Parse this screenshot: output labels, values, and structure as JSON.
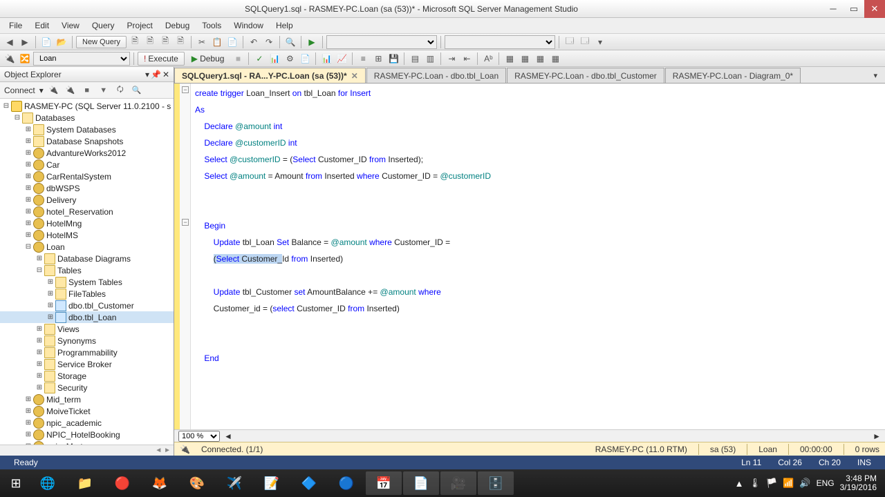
{
  "title": "SQLQuery1.sql - RASMEY-PC.Loan (sa (53))* - Microsoft SQL Server Management Studio",
  "menu": [
    "File",
    "Edit",
    "View",
    "Query",
    "Project",
    "Debug",
    "Tools",
    "Window",
    "Help"
  ],
  "toolbar": {
    "new_query": "New Query",
    "execute": "Execute",
    "debug": "Debug",
    "db_selected": "Loan"
  },
  "explorer": {
    "title": "Object Explorer",
    "connect": "Connect",
    "server": "RASMEY-PC (SQL Server 11.0.2100 - s",
    "folders": {
      "databases": "Databases",
      "sysdb": "System Databases",
      "snapshots": "Database Snapshots"
    },
    "dbs": [
      "AdvantureWorks2012",
      "Car",
      "CarRentalSystem",
      "dbWSPS",
      "Delivery",
      "hotel_Reservation",
      "HotelMng",
      "HotelMS",
      "Loan",
      "Mid_term",
      "MoiveTicket",
      "npic_academic",
      "NPIC_HotelBooking",
      "npic_Mart"
    ],
    "loan_children": {
      "diagrams": "Database Diagrams",
      "tables": "Tables",
      "systables": "System Tables",
      "filetables": "FileTables",
      "tbl_customer": "dbo.tbl_Customer",
      "tbl_loan": "dbo.tbl_Loan",
      "views": "Views",
      "synonyms": "Synonyms",
      "prog": "Programmability",
      "sb": "Service Broker",
      "storage": "Storage",
      "security": "Security"
    }
  },
  "tabs": [
    {
      "label": "SQLQuery1.sql - RA...Y-PC.Loan (sa (53))*",
      "active": true
    },
    {
      "label": "RASMEY-PC.Loan - dbo.tbl_Loan",
      "active": false
    },
    {
      "label": "RASMEY-PC.Loan - dbo.tbl_Customer",
      "active": false
    },
    {
      "label": "RASMEY-PC.Loan - Diagram_0*",
      "active": false
    }
  ],
  "zoom": "100 %",
  "status1": {
    "conn_icon": "🔌",
    "conn": "Connected. (1/1)",
    "server": "RASMEY-PC (11.0 RTM)",
    "user": "sa (53)",
    "db": "Loan",
    "time": "00:00:00",
    "rows": "0 rows"
  },
  "status2": {
    "ready": "Ready",
    "ln": "Ln 11",
    "col": "Col 26",
    "ch": "Ch 20",
    "ins": "INS"
  },
  "tray": {
    "lang": "ENG",
    "time": "3:48 PM",
    "date": "3/19/2016"
  },
  "code": {
    "l1_a": "create",
    "l1_b": "trigger",
    "l1_c": "Loan_Insert",
    "l1_d": "on",
    "l1_e": "tbl_Loan",
    "l1_f": "for",
    "l1_g": "Insert",
    "l2": "As",
    "l3_a": "Declare",
    "l3_b": "@amount",
    "l3_c": "int",
    "l4_a": "Declare",
    "l4_b": "@customerID",
    "l4_c": "int",
    "l5_a": "Select",
    "l5_b": "@customerID",
    "l5_c": "=",
    "l5_d": "(",
    "l5_e": "Select",
    "l5_f": "Customer_ID",
    "l5_g": "from",
    "l5_h": "Inserted",
    "l5_i": ");",
    "l6_a": "Select",
    "l6_b": "@amount",
    "l6_c": "= Amount",
    "l6_d": "from",
    "l6_e": "Inserted",
    "l6_f": "where",
    "l6_g": "Customer_ID =",
    "l6_h": "@customerID",
    "l8": "Begin",
    "l9_a": "Update",
    "l9_b": "tbl_Loan",
    "l9_c": "Set",
    "l9_d": "Balance =",
    "l9_e": "@amount",
    "l9_f": "where",
    "l9_g": "Customer_ID =",
    "l10_a": "(",
    "l10_b": "Select",
    "l10_c": "Customer_",
    "l10_d": "Id",
    "l10_e": "from",
    "l10_f": "Inserted",
    "l10_g": ")",
    "l12_a": "Update",
    "l12_b": "tbl_Customer",
    "l12_c": "set",
    "l12_d": "AmountBalance +=",
    "l12_e": "@amount",
    "l12_f": "where",
    "l13_a": "Customer_id = (",
    "l13_b": "select",
    "l13_c": "Customer_ID",
    "l13_d": "from",
    "l13_e": "Inserted",
    "l13_f": ")",
    "l15": "End"
  }
}
